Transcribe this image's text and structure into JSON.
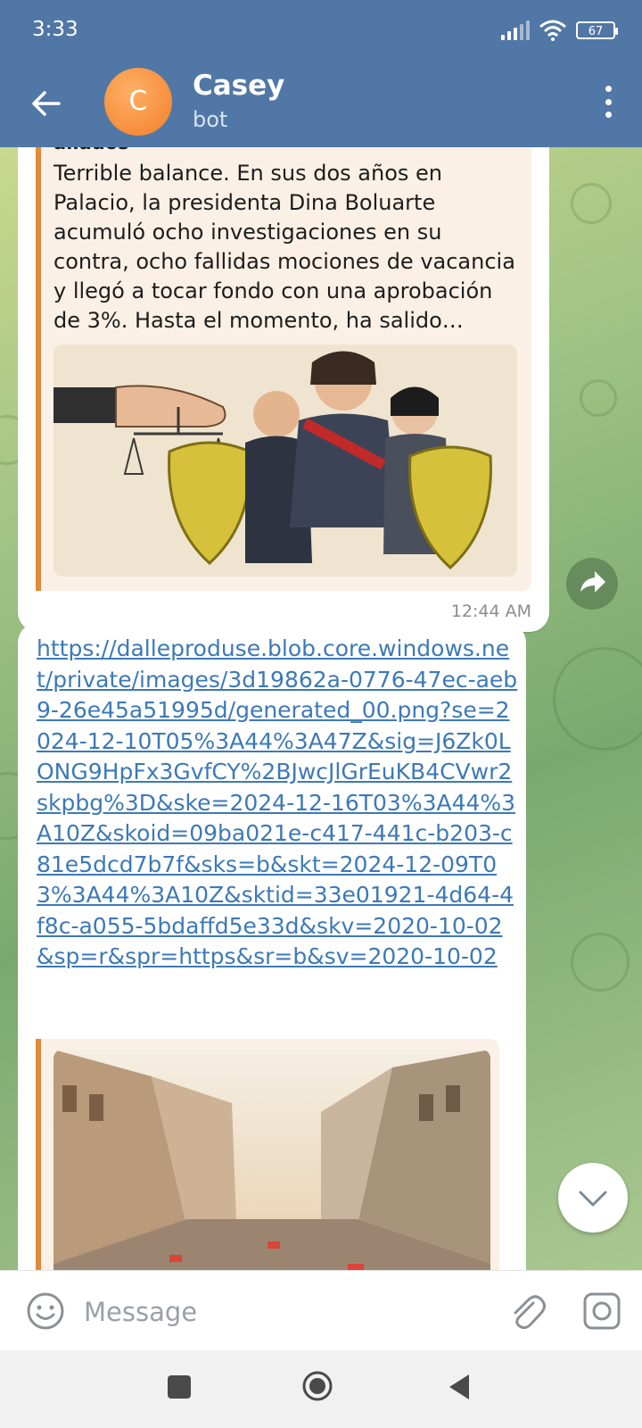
{
  "status_bar": {
    "time": "3:33",
    "battery": "67"
  },
  "header": {
    "avatar_letter": "C",
    "title": "Casey",
    "subtitle": "bot"
  },
  "messages": [
    {
      "quote_title": "aliados",
      "quote_text": "Terrible balance. En sus dos años en Palacio, la presidenta Dina Boluarte acumuló ocho investigaciones en su contra, ocho fallidas mociones de vacancia y llegó a tocar fondo con una aprobación de 3%. Hasta el momento, ha salido…",
      "time": "12:44 AM"
    },
    {
      "link": "https://dalleproduse.blob.core.windows.net/private/images/3d19862a-0776-47ec-aeb9-26e45a51995d/generated_00.png?se=2024-12-10T05%3A44%3A47Z&sig=J6Zk0LONG9HpFx3GvfCY%2BJwcJlGrEuKB4CVwr2skpbg%3D&ske=2024-12-16T03%3A44%3A10Z&skoid=09ba021e-c417-441c-b203-c81e5dcd7b7f&sks=b&skt=2024-12-09T03%3A44%3A10Z&sktid=33e01921-4d64-4f8c-a055-5bdaffd5e33d&skv=2020-10-02&sp=r&spr=https&sr=b&sv=2020-10-02"
    }
  ],
  "composer": {
    "placeholder": "Message"
  },
  "colors": {
    "header": "#5077a5",
    "link": "#3d79b7",
    "quote_bar": "#e08a3a",
    "avatar": "#f27f29"
  },
  "icons": [
    "back-arrow-icon",
    "more-vert-icon",
    "share-icon",
    "chevron-down-icon",
    "emoji-icon",
    "attach-icon",
    "camera-icon",
    "nav-recents-icon",
    "nav-home-icon",
    "nav-back-icon",
    "wifi-icon",
    "signal-icon",
    "battery-icon"
  ]
}
